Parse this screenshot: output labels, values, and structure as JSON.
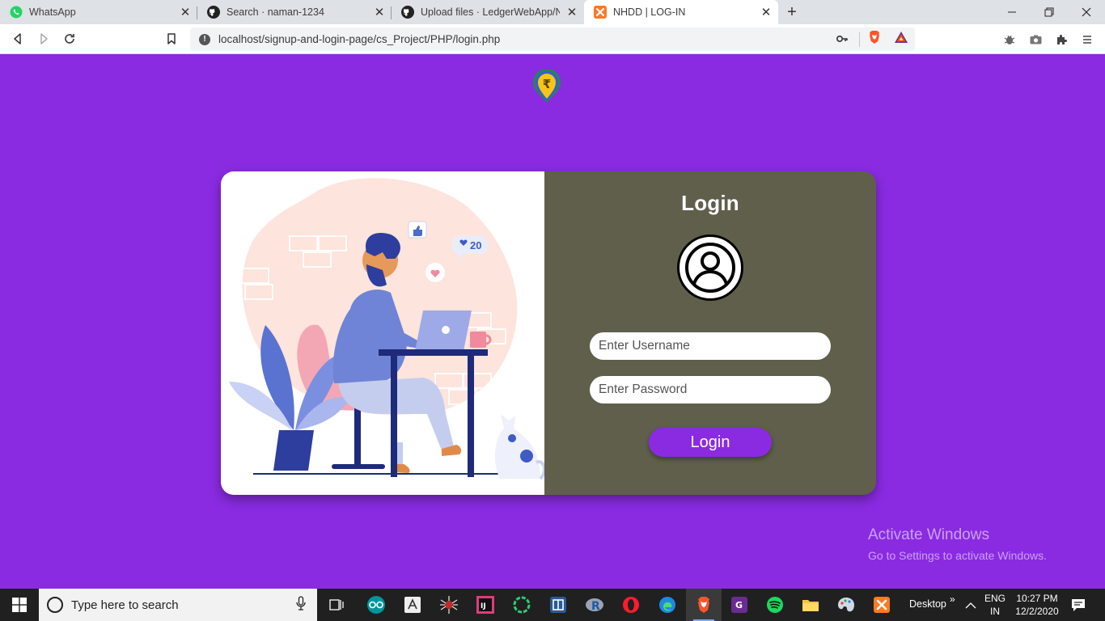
{
  "browser": {
    "tabs": [
      {
        "title": "WhatsApp",
        "icon": "whatsapp-icon"
      },
      {
        "title": "Search · naman-1234",
        "icon": "github-icon"
      },
      {
        "title": "Upload files · LedgerWebApp/NHD",
        "icon": "github-icon"
      },
      {
        "title": "NHDD | LOG-IN",
        "icon": "xampp-icon"
      }
    ],
    "url": "localhost/signup-and-login-page/cs_Project/PHP/login.php"
  },
  "page": {
    "login_title": "Login",
    "username_placeholder": "Enter Username",
    "password_placeholder": "Enter Password",
    "login_button": "Login",
    "illustration_like_count": "20",
    "brand_color": "#8a2be2",
    "panel_color": "#5f5f4c"
  },
  "watermark": {
    "line1": "Activate Windows",
    "line2": "Go to Settings to activate Windows."
  },
  "taskbar": {
    "search_placeholder": "Type here to search",
    "desktop_label": "Desktop",
    "lang_top": "ENG",
    "lang_bottom": "IN",
    "time": "10:27 PM",
    "date": "12/2/2020"
  }
}
